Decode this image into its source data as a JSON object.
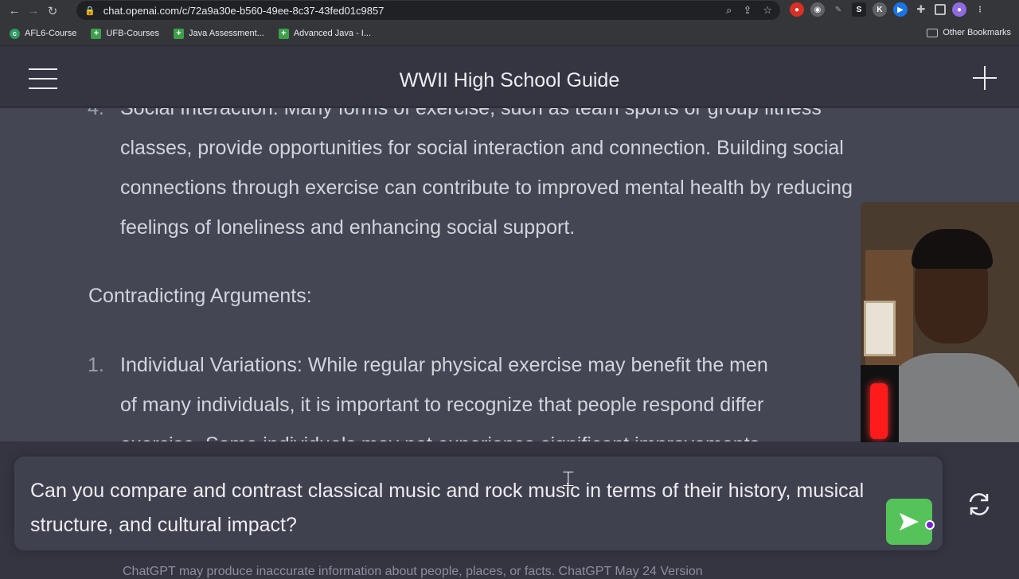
{
  "browser": {
    "url": "chat.openai.com/c/72a9a30e-b560-49ee-8c37-43fed01c9857",
    "bookmarks": [
      "AFL6-Course",
      "UFB-Courses",
      "Java Assessment...",
      "Advanced Java - I..."
    ],
    "other_bookmarks": "Other Bookmarks"
  },
  "header": {
    "title": "WWII High School Guide"
  },
  "conversation": {
    "item4_number": "4.",
    "item4_lines": [
      "Social Interaction: Many forms of exercise, such as team sports or group fitness",
      "classes, provide opportunities for social interaction and connection. Building social",
      "connections through exercise can contribute to improved mental health by reducing",
      "feelings of loneliness and enhancing social support."
    ],
    "section_heading": "Contradicting Arguments:",
    "item1_number": "1.",
    "item1_lines": [
      "Individual Variations: While regular physical exercise may benefit the men",
      "of many individuals, it is important to recognize that people respond differ",
      "exercise. Some individuals may not experience significant improvements"
    ]
  },
  "input": {
    "text": "Can you compare and contrast classical music and rock music in terms of their history, musical structure, and cultural impact?"
  },
  "footer": {
    "note": "ChatGPT may produce inaccurate information about people, places, or facts. ChatGPT May 24 Version"
  },
  "colors": {
    "accent_send": "#55c35a",
    "background": "#343541",
    "message_bg": "#444654"
  }
}
